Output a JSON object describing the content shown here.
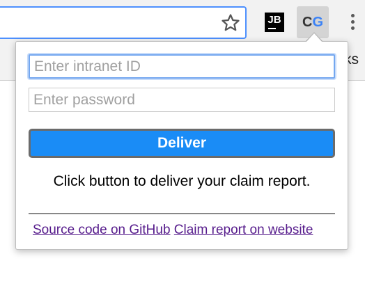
{
  "browser": {
    "star_icon": "star-icon",
    "extension_jb": {
      "text": "JB",
      "icon": "jetbrains-icon"
    },
    "extension_cg": {
      "c": "C",
      "g": "G",
      "c_color": "#333333",
      "g_color": "#3b82f6"
    },
    "menu_icon": "vertical-dots-icon",
    "bookmarks_partial_text": "ks"
  },
  "popup": {
    "intranet_placeholder": "Enter intranet ID",
    "intranet_value": "",
    "password_placeholder": "Enter password",
    "password_value": "",
    "deliver_label": "Deliver",
    "message": "Click button to deliver your claim report.",
    "links": [
      {
        "label": "Source code on GitHub"
      },
      {
        "label": "Claim report on website"
      }
    ],
    "colors": {
      "button_bg": "#1a8cf6",
      "link": "#551a8b",
      "focus_border": "#74a7ef"
    }
  }
}
